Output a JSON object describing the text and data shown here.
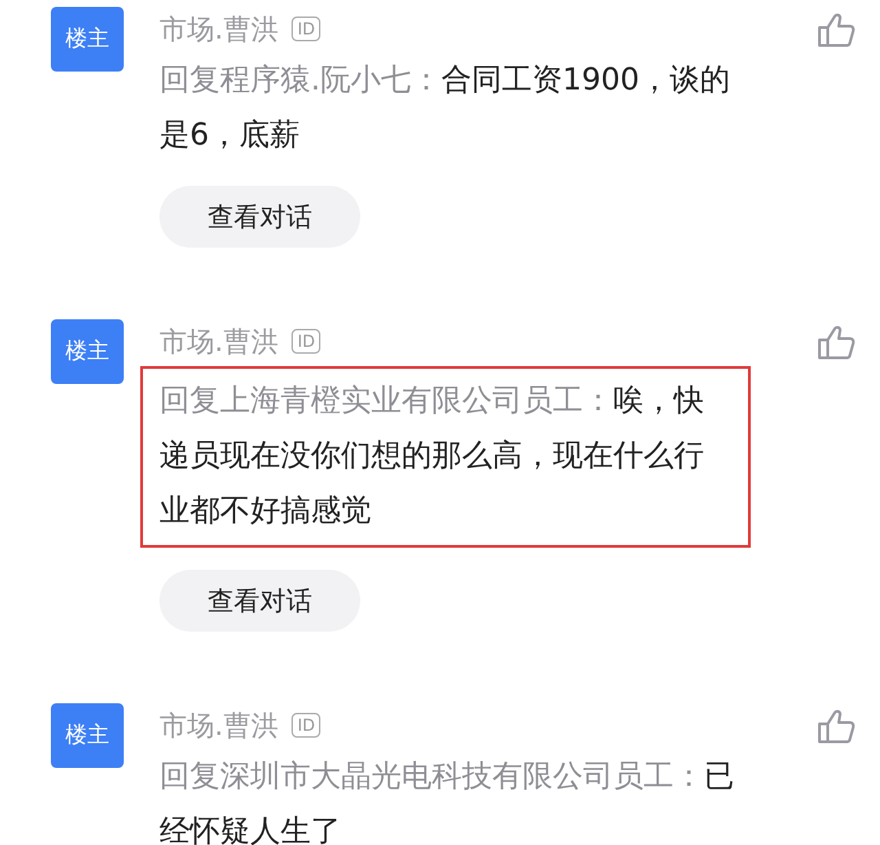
{
  "comments": [
    {
      "badge": "楼主",
      "author": "市场.曹洪",
      "id_badge": "ID",
      "reply_to": "回复程序猿.阮小七：",
      "content": "合同工资1900，谈的是6，底薪",
      "highlighted": false,
      "button": "查看对话"
    },
    {
      "badge": "楼主",
      "author": "市场.曹洪",
      "id_badge": "ID",
      "reply_to": "回复上海青橙实业有限公司员工：",
      "content": "唉，快递员现在没你们想的那么高，现在什么行业都不好搞感觉",
      "highlighted": true,
      "button": "查看对话"
    },
    {
      "badge": "楼主",
      "author": "市场.曹洪",
      "id_badge": "ID",
      "reply_to": "回复深圳市大晶光电科技有限公司员工：",
      "content": "已经怀疑人生了",
      "highlighted": false
    }
  ]
}
